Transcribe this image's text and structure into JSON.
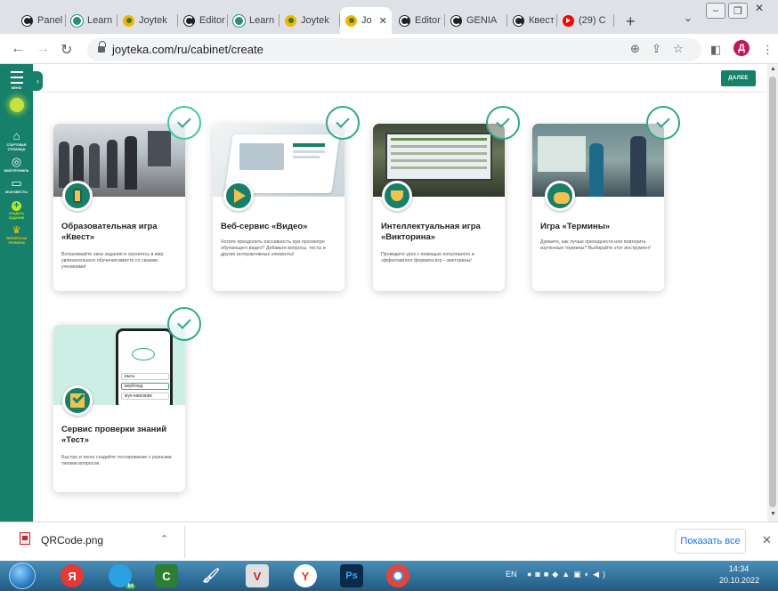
{
  "browser": {
    "tabs": [
      {
        "label": "Panel",
        "icon": "chrome-g-icon"
      },
      {
        "label": "Learn",
        "icon": "learning-apps-icon"
      },
      {
        "label": "Joytek",
        "icon": "joyteka-icon"
      },
      {
        "label": "Editor",
        "icon": "chrome-g-icon"
      },
      {
        "label": "Learn",
        "icon": "learning-apps-icon"
      },
      {
        "label": "Joytek",
        "icon": "joyteka-icon"
      },
      {
        "label": "Jo",
        "icon": "joyteka-icon",
        "active": true
      },
      {
        "label": "Editor",
        "icon": "chrome-g-icon"
      },
      {
        "label": "GENIA",
        "icon": "chrome-g-icon"
      },
      {
        "label": "Квест",
        "icon": "chrome-g-icon"
      },
      {
        "label": "(29) C",
        "icon": "youtube-icon"
      }
    ],
    "new_tab": "+",
    "tab_close": "✕",
    "url": "joyteka.com/ru/cabinet/create",
    "profile_initial": "Д"
  },
  "sidebar": {
    "menu_label": "МЕНЮ",
    "items": [
      {
        "label": "СТАРТОВАЯ СТРАНИЦА",
        "icon": "home-icon"
      },
      {
        "label": "МОЙ ПРОФИЛЬ",
        "icon": "profile-icon"
      },
      {
        "label": "МОИ КВЕСТЫ",
        "icon": "folder-icon"
      },
      {
        "label": "СОЗДАТЬ ЗАДАНИЕ",
        "icon": "plus-icon"
      },
      {
        "label": "ПЕРЕЙТИ НА ПРЕМИУМ",
        "icon": "crown-icon"
      }
    ]
  },
  "header": {
    "next_label": "ДАЛЕЕ"
  },
  "cards": [
    {
      "title": "Образовательная игра «Квест»",
      "desc": "Вотрачивайте свои задания и окунитесь в мир увлекательного обучения вместе со своими учениками!"
    },
    {
      "title": "Веб-сервис «Видео»",
      "desc": "Хотите преодолеть пассивность при просмотре обучающего видео? Добавьте вопросы, тесты и другие интерактивные элементы!"
    },
    {
      "title": "Интеллектуальная игра «Викторина»",
      "desc": "Проведите урок с помощью популярного и эффективного формата игр – викторины!"
    },
    {
      "title": "Игра «Термины»",
      "desc": "Думаете, как лучше преподнести или повторить изученные термины? Выбирайте этот инструмент!"
    },
    {
      "title": "Сервис проверки знаний «Тест»",
      "desc": "Быстро и легко создайте тестирование с разными типами вопросов."
    }
  ],
  "phone_mock": {
    "options": [
      "рысь",
      "верблюд",
      "жук-навозник"
    ]
  },
  "downloads": {
    "file_name": "QRCode.png",
    "show_all": "Показать все"
  },
  "taskbar": {
    "lang": "EN",
    "time": "14:34",
    "date": "20.10.2022",
    "ps_label": "Ps",
    "yandex_label": "Я",
    "badge_count": "84"
  },
  "colors": {
    "brand": "#16806a",
    "accent": "#2fa88c",
    "link": "#1a73e8"
  }
}
